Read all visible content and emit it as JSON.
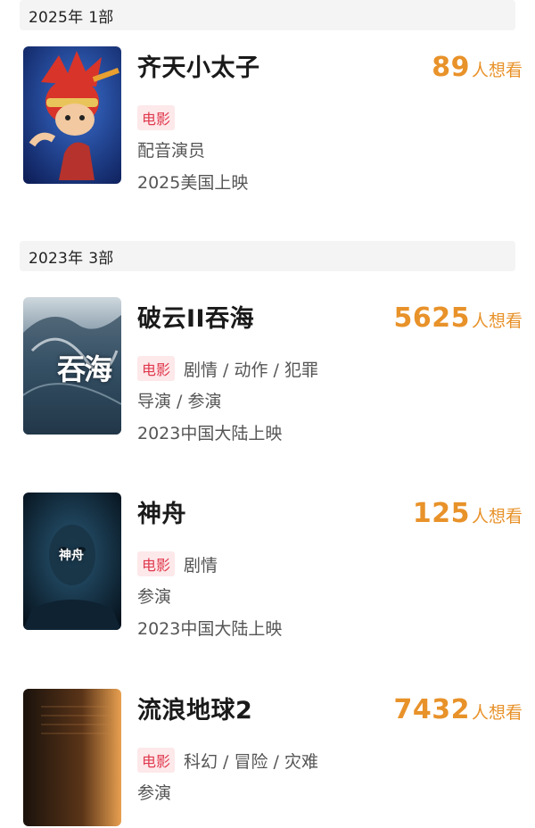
{
  "sections": [
    {
      "year": "2025年",
      "count": "1部",
      "items": [
        {
          "title": "齐天小太子",
          "want_count": "89",
          "want_suffix": "人想看",
          "badge": "电影",
          "genres": "",
          "role": "配音演员",
          "release": "2025美国上映"
        }
      ]
    },
    {
      "year": "2023年",
      "count": "3部",
      "items": [
        {
          "title": "破云II吞海",
          "want_count": "5625",
          "want_suffix": "人想看",
          "badge": "电影",
          "genres": "剧情 / 动作 / 犯罪",
          "role": "导演 / 参演",
          "release": "2023中国大陆上映",
          "poster_text": "吞海"
        },
        {
          "title": "神舟",
          "want_count": "125",
          "want_suffix": "人想看",
          "badge": "电影",
          "genres": "剧情",
          "role": "参演",
          "release": "2023中国大陆上映",
          "poster_text": "神舟"
        },
        {
          "title": "流浪地球2",
          "want_count": "7432",
          "want_suffix": "人想看",
          "badge": "电影",
          "genres": "科幻 / 冒险 / 灾难",
          "role": "参演",
          "release": ""
        }
      ]
    }
  ],
  "colors": {
    "accent_orange": "#e8922a",
    "badge_red": "#e03a4e",
    "badge_bg": "#fde8ea"
  }
}
